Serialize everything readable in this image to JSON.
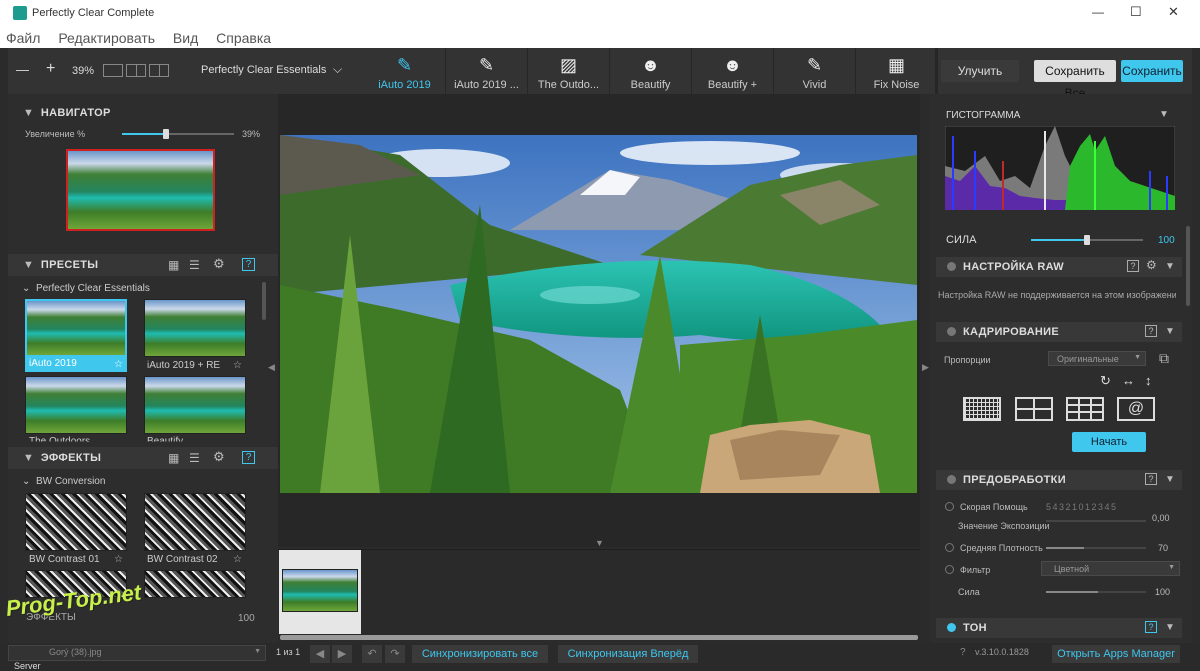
{
  "window": {
    "title": "Perfectly Clear Complete",
    "controls": [
      "—",
      "☐",
      "✕"
    ]
  },
  "menu": [
    "Файл",
    "Редактировать",
    "Вид",
    "Справка"
  ],
  "toolbar": {
    "zoom_minus": "—",
    "zoom_plus": "+",
    "zoom_value": "39%",
    "preset_group": "Perfectly Clear Essentials",
    "tabs": [
      {
        "label": "iAuto 2019",
        "icon": "brush-2019-icon",
        "active": true
      },
      {
        "label": "iAuto 2019 ...",
        "icon": "brush-2019-icon"
      },
      {
        "label": "The Outdo...",
        "icon": "landscape-icon"
      },
      {
        "label": "Beautify",
        "icon": "face-icon"
      },
      {
        "label": "Beautify +",
        "icon": "face-plus-icon"
      },
      {
        "label": "Vivid",
        "icon": "brush-icon"
      },
      {
        "label": "Fix Noise",
        "icon": "noise-icon"
      }
    ],
    "improve_label": "Улучить",
    "save_all_label": "Сохранить Все",
    "save_label": "Сохранить"
  },
  "navigator": {
    "title": "НАВИГАТОР",
    "zoom_label": "Увеличение %",
    "zoom_value": "39%",
    "zoom_level": 0.39
  },
  "presets": {
    "title": "ПРЕСЕТЫ",
    "group": "Perfectly Clear Essentials",
    "items": [
      "iAuto 2019",
      "iAuto 2019 + RE",
      "The Outdoors",
      "Beautify"
    ]
  },
  "effects": {
    "title": "ЭФФЕКТЫ",
    "group": "BW Conversion",
    "items": [
      "BW Contrast 01",
      "BW Contrast 02"
    ],
    "footer_label": "ЭФФЕКТЫ",
    "footer_value": "100"
  },
  "watermark": "Prog-Top.net",
  "right_panel": {
    "histogram_title": "ГИСТОГРАММА",
    "strength_label": "СИЛА",
    "strength_value": "100",
    "raw_title": "НАСТРОЙКА RAW",
    "raw_note": "Настройка RAW не поддерживается на этом изображении",
    "crop_title": "КАДРИРОВАНИЕ",
    "proportions_label": "Пропорции",
    "proportions_value": "Оригинальные",
    "start_label": "Начать",
    "pre_title": "ПРЕДОБРАБОТКИ",
    "quick_help_label": "Скорая Помощь",
    "exposure_scale": "5 4 3 2 1 0 1 2 3 4 5",
    "exposure_label": "Значение Экспозиции",
    "exposure_value": "0,00",
    "density_label": "Средняя Плотность",
    "density_value": "70",
    "filter_label": "Фильтр",
    "filter_value": "Цветной",
    "power_label": "Сила",
    "power_value": "100",
    "tone_title": "ТОН"
  },
  "status": {
    "file": "Gorý (38).jpg",
    "page": "1 из 1",
    "sync_all": "Синхронизировать все",
    "sync_forward": "Синхронизация Вперёд",
    "version": "v.3.10.0.1828",
    "apps_manager": "Открыть Apps Manager",
    "server": "Server"
  }
}
